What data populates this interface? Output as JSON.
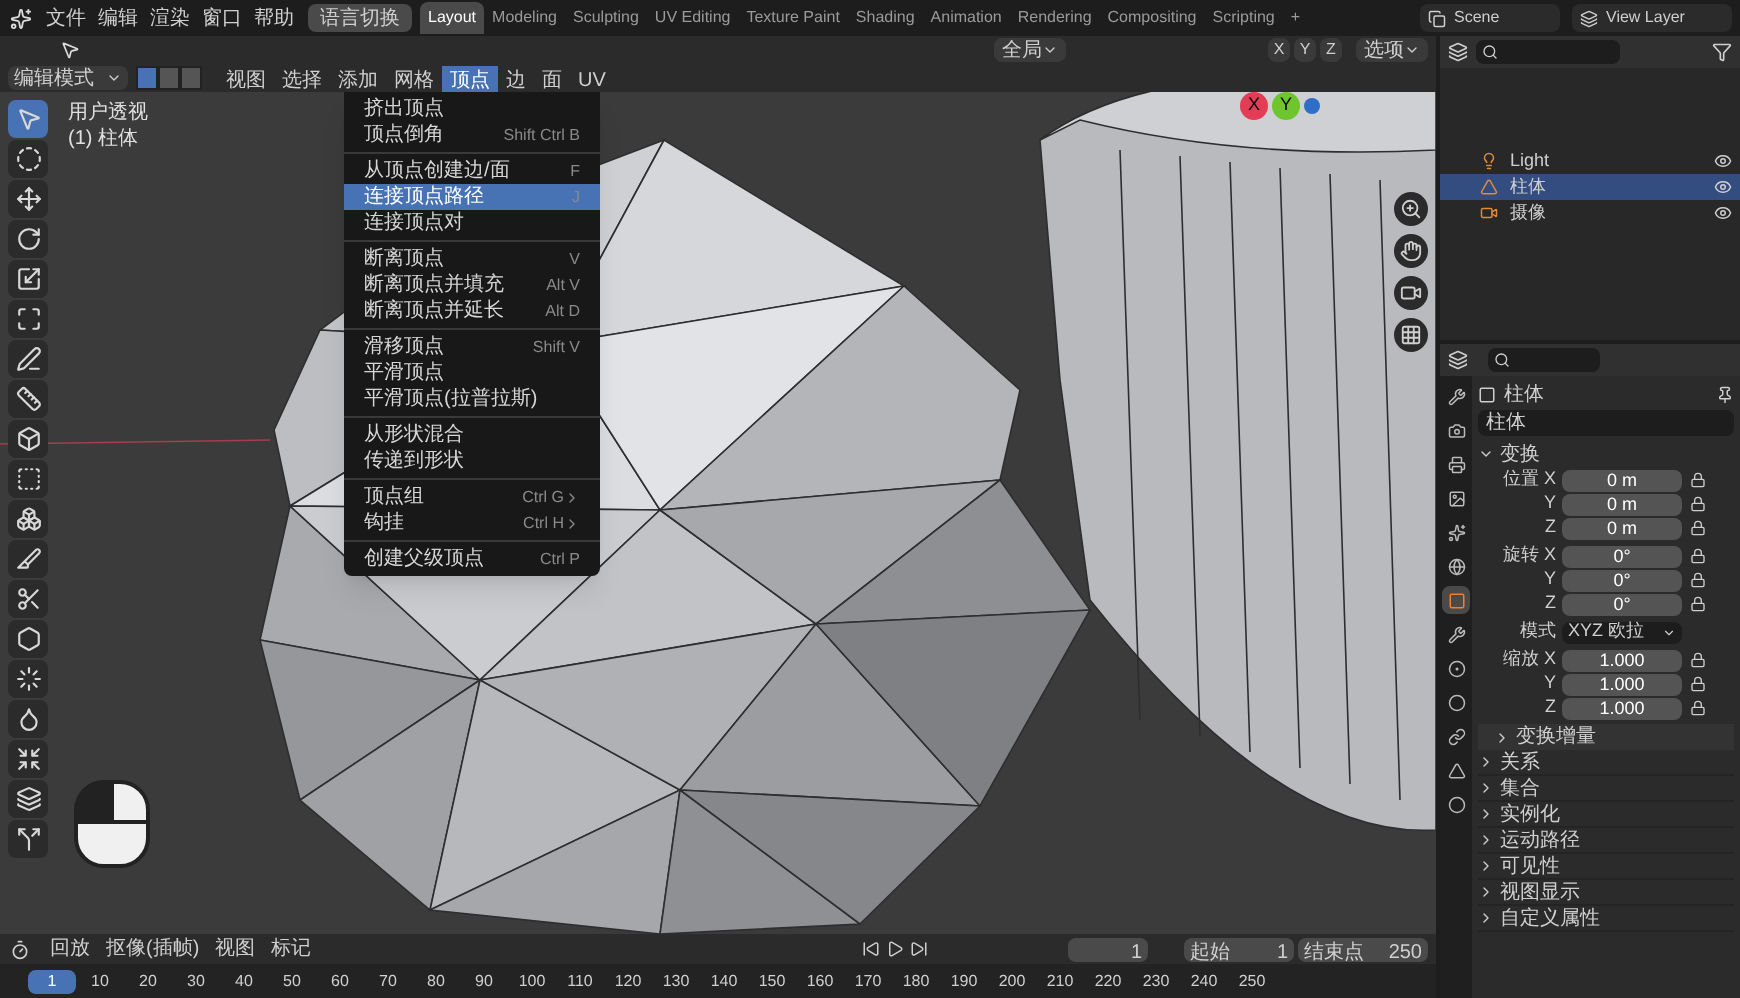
{
  "top_menu": [
    "文件",
    "编辑",
    "渲染",
    "窗口",
    "帮助"
  ],
  "language_button": "语言切换",
  "workspace_tabs": [
    {
      "label": "Layout",
      "selected": true
    },
    {
      "label": "Modeling",
      "selected": false
    },
    {
      "label": "Sculpting",
      "selected": false
    },
    {
      "label": "UV Editing",
      "selected": false
    },
    {
      "label": "Texture Paint",
      "selected": false
    },
    {
      "label": "Shading",
      "selected": false
    },
    {
      "label": "Animation",
      "selected": false
    },
    {
      "label": "Rendering",
      "selected": false
    },
    {
      "label": "Compositing",
      "selected": false
    },
    {
      "label": "Scripting",
      "selected": false
    },
    {
      "label": "+",
      "selected": false
    }
  ],
  "scene": "Scene",
  "view_layer": "View Layer",
  "tool_header": {
    "orientation": "全局",
    "axes": [
      "X",
      "Y",
      "Z"
    ],
    "pivot": "选项"
  },
  "editor_header": {
    "mode": "编辑模式",
    "select_modes": [
      {
        "selected": true
      },
      {
        "selected": false
      },
      {
        "selected": false
      }
    ],
    "menus": [
      {
        "label": "视图",
        "selected": false
      },
      {
        "label": "选择",
        "selected": false
      },
      {
        "label": "添加",
        "selected": false
      },
      {
        "label": "网格",
        "selected": false
      },
      {
        "label": "顶点",
        "selected": true
      },
      {
        "label": "边",
        "selected": false
      },
      {
        "label": "面",
        "selected": false
      },
      {
        "label": "UV",
        "selected": false
      }
    ]
  },
  "viewport": {
    "view_name": "用户透视",
    "object_name": "(1) 柱体",
    "gizmo_axes": [
      "X",
      "Y"
    ]
  },
  "toolbar": [
    {
      "kind": "select",
      "selected": true
    },
    {
      "kind": "cursor",
      "selected": false
    },
    {
      "kind": "move",
      "selected": false
    },
    {
      "kind": "rotate",
      "selected": false
    },
    {
      "kind": "scale",
      "selected": false
    },
    {
      "kind": "transform",
      "selected": false
    },
    {
      "kind": "annotate",
      "selected": false
    },
    {
      "kind": "measure",
      "selected": false
    },
    {
      "kind": "extrude",
      "selected": false
    },
    {
      "kind": "inset",
      "selected": false
    },
    {
      "kind": "bevel",
      "selected": false
    },
    {
      "kind": "loopcut",
      "selected": false
    },
    {
      "kind": "knife",
      "selected": false
    },
    {
      "kind": "polybuild",
      "selected": false
    },
    {
      "kind": "spin",
      "selected": false
    },
    {
      "kind": "smooth",
      "selected": false
    },
    {
      "kind": "shrink",
      "selected": false
    },
    {
      "kind": "shear",
      "selected": false
    },
    {
      "kind": "rip",
      "selected": false
    }
  ],
  "vertex_menu": {
    "groups": [
      [
        {
          "label": "挤出顶点",
          "selected": false
        },
        {
          "label": "顶点倒角",
          "shortcut": "Shift Ctrl B",
          "selected": false
        }
      ],
      [
        {
          "label": "从顶点创建边/面",
          "shortcut": "F",
          "selected": false
        },
        {
          "label": "连接顶点路径",
          "shortcut": "J",
          "selected": true
        },
        {
          "label": "连接顶点对",
          "selected": false
        }
      ],
      [
        {
          "label": "断离顶点",
          "shortcut": "V",
          "selected": false
        },
        {
          "label": "断离顶点并填充",
          "shortcut": "Alt V",
          "selected": false
        },
        {
          "label": "断离顶点并延长",
          "shortcut": "Alt D",
          "selected": false
        }
      ],
      [
        {
          "label": "滑移顶点",
          "shortcut": "Shift V",
          "selected": false
        },
        {
          "label": "平滑顶点",
          "selected": false
        },
        {
          "label": "平滑顶点(拉普拉斯)",
          "selected": false
        }
      ],
      [
        {
          "label": "从形状混合",
          "selected": false
        },
        {
          "label": "传递到形状",
          "selected": false
        }
      ],
      [
        {
          "label": "顶点组",
          "shortcut": "Ctrl G",
          "submenu": true,
          "selected": false
        },
        {
          "label": "钩挂",
          "shortcut": "Ctrl H",
          "submenu": true,
          "selected": false
        }
      ],
      [
        {
          "label": "创建父级顶点",
          "shortcut": "Ctrl P",
          "selected": false
        }
      ]
    ]
  },
  "outliner": {
    "rows": [
      {
        "label": "Light",
        "kind": "light",
        "selected": false
      },
      {
        "label": "柱体",
        "kind": "mesh",
        "selected": true
      },
      {
        "label": "摄像",
        "kind": "camera",
        "selected": false
      }
    ]
  },
  "properties": {
    "object_name": "柱体",
    "data_name": "柱体",
    "tabs": [
      {
        "kind": "tool",
        "selected": false
      },
      {
        "kind": "render",
        "selected": false
      },
      {
        "kind": "output",
        "selected": false
      },
      {
        "kind": "view",
        "selected": false
      },
      {
        "kind": "scene",
        "selected": false
      },
      {
        "kind": "world",
        "selected": false
      },
      {
        "kind": "object",
        "selected": true
      },
      {
        "kind": "modifier",
        "selected": false
      },
      {
        "kind": "particles",
        "selected": false
      },
      {
        "kind": "physics",
        "selected": false
      },
      {
        "kind": "constraints",
        "selected": false
      },
      {
        "kind": "data",
        "selected": false
      },
      {
        "kind": "material",
        "selected": false
      }
    ],
    "transform": {
      "title": "变换",
      "expanded": true,
      "rows": [
        {
          "kind": "field",
          "label": "位置 X",
          "value": "0 m",
          "lockable": true
        },
        {
          "kind": "field",
          "label": "Y",
          "value": "0 m",
          "lockable": true
        },
        {
          "kind": "field",
          "label": "Z",
          "value": "0 m",
          "lockable": true
        },
        {
          "kind": "field",
          "label": "旋转 X",
          "value": "0°",
          "lockable": true
        },
        {
          "kind": "field",
          "label": "Y",
          "value": "0°",
          "lockable": true
        },
        {
          "kind": "field",
          "label": "Z",
          "value": "0°",
          "lockable": true
        },
        {
          "kind": "dropdown",
          "label": "模式",
          "value": "XYZ 欧拉",
          "lockable": false
        },
        {
          "kind": "field",
          "label": "缩放 X",
          "value": "1.000",
          "lockable": true
        },
        {
          "kind": "field",
          "label": "Y",
          "value": "1.000",
          "lockable": true
        },
        {
          "kind": "field",
          "label": "Z",
          "value": "1.000",
          "lockable": true
        }
      ],
      "subsection": {
        "title": "变换增量",
        "expanded": false
      }
    },
    "sections": [
      {
        "title": "关系",
        "expanded": false
      },
      {
        "title": "集合",
        "expanded": false
      },
      {
        "title": "实例化",
        "expanded": false
      },
      {
        "title": "运动路径",
        "expanded": false
      },
      {
        "title": "可见性",
        "expanded": false
      },
      {
        "title": "视图显示",
        "expanded": false
      },
      {
        "title": "自定义属性",
        "expanded": false
      }
    ]
  },
  "timeline": {
    "menus": [
      "回放",
      "抠像(插帧)",
      "视图",
      "标记"
    ],
    "current_frame": "1",
    "start_label": "起始",
    "start": "1",
    "end_label": "结束点",
    "end": "250",
    "ticks": [
      {
        "label": "1",
        "selected": true
      },
      {
        "label": "10",
        "selected": false
      },
      {
        "label": "20",
        "selected": false
      },
      {
        "label": "30",
        "selected": false
      },
      {
        "label": "40",
        "selected": false
      },
      {
        "label": "50",
        "selected": false
      },
      {
        "label": "60",
        "selected": false
      },
      {
        "label": "70",
        "selected": false
      },
      {
        "label": "80",
        "selected": false
      },
      {
        "label": "90",
        "selected": false
      },
      {
        "label": "100",
        "selected": false
      },
      {
        "label": "110",
        "selected": false
      },
      {
        "label": "120",
        "selected": false
      },
      {
        "label": "130",
        "selected": false
      },
      {
        "label": "140",
        "selected": false
      },
      {
        "label": "150",
        "selected": false
      },
      {
        "label": "160",
        "selected": false
      },
      {
        "label": "170",
        "selected": false
      },
      {
        "label": "180",
        "selected": false
      },
      {
        "label": "190",
        "selected": false
      },
      {
        "label": "200",
        "selected": false
      },
      {
        "label": "210",
        "selected": false
      },
      {
        "label": "220",
        "selected": false
      },
      {
        "label": "230",
        "selected": false
      },
      {
        "label": "240",
        "selected": false
      },
      {
        "label": "250",
        "selected": false
      }
    ]
  }
}
